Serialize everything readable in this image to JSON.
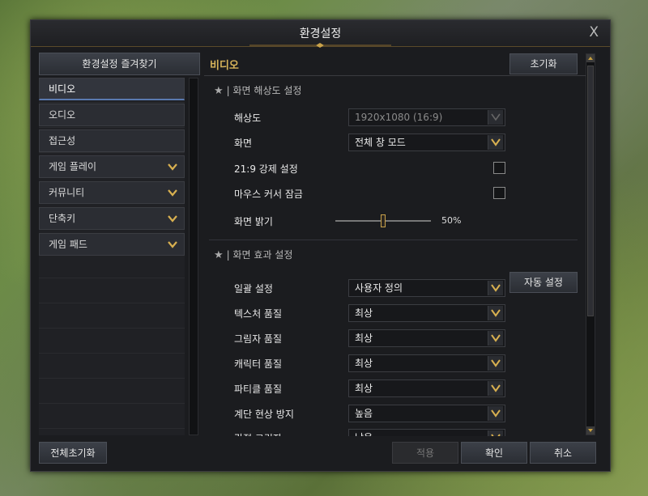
{
  "window": {
    "title": "환경설정",
    "close_label": "X"
  },
  "sidebar": {
    "favorites_label": "환경설정 즐겨찾기",
    "items": [
      {
        "label": "비디오",
        "active": true,
        "expandable": false
      },
      {
        "label": "오디오",
        "active": false,
        "expandable": false
      },
      {
        "label": "접근성",
        "active": false,
        "expandable": false
      },
      {
        "label": "게임 플레이",
        "active": false,
        "expandable": true
      },
      {
        "label": "커뮤니티",
        "active": false,
        "expandable": true
      },
      {
        "label": "단축키",
        "active": false,
        "expandable": true
      },
      {
        "label": "게임 패드",
        "active": false,
        "expandable": true
      }
    ]
  },
  "content": {
    "title": "비디오",
    "reset_label": "초기화",
    "resolution_section": {
      "title": "화면 해상도 설정",
      "resolution": {
        "label": "해상도",
        "value": "1920x1080 (16:9)"
      },
      "screen": {
        "label": "화면",
        "value": "전체 창 모드"
      },
      "force_219": {
        "label": "21:9 강제 설정",
        "checked": false
      },
      "mouse_lock": {
        "label": "마우스 커서 잠금",
        "checked": false
      },
      "brightness": {
        "label": "화면 밝기",
        "value": "50%",
        "level": 0.5
      }
    },
    "effects_section": {
      "title": "화면 효과 설정",
      "auto_label": "자동 설정",
      "rows": [
        {
          "label": "일괄 설정",
          "value": "사용자 정의"
        },
        {
          "label": "텍스처 품질",
          "value": "최상"
        },
        {
          "label": "그림자 품질",
          "value": "최상"
        },
        {
          "label": "캐릭터 품질",
          "value": "최상"
        },
        {
          "label": "파티클 품질",
          "value": "최상"
        },
        {
          "label": "계단 현상 방지",
          "value": "높음"
        },
        {
          "label": "간접 그림자",
          "value": "낮음"
        }
      ]
    }
  },
  "footer": {
    "reset_all": "전체초기화",
    "apply": "적용",
    "confirm": "확인",
    "cancel": "취소"
  },
  "colors": {
    "accent_gold": "#c9a24a",
    "title_gold": "#d7b45a",
    "active_underline": "#5a7ab0"
  }
}
